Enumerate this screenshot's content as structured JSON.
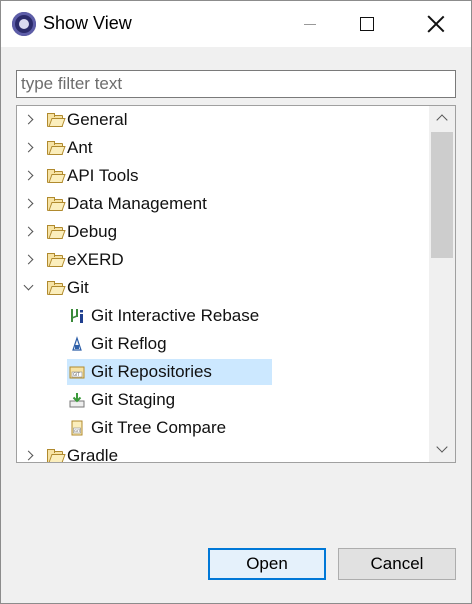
{
  "window": {
    "title": "Show View",
    "icon": "eclipse-app-icon"
  },
  "filter": {
    "value": "",
    "placeholder": "type filter text"
  },
  "tree": {
    "items": [
      {
        "label": "General",
        "expanded": false,
        "icon": "folder-icon"
      },
      {
        "label": "Ant",
        "expanded": false,
        "icon": "folder-icon"
      },
      {
        "label": "API Tools",
        "expanded": false,
        "icon": "folder-icon"
      },
      {
        "label": "Data Management",
        "expanded": false,
        "icon": "folder-icon"
      },
      {
        "label": "Debug",
        "expanded": false,
        "icon": "folder-icon"
      },
      {
        "label": "eXERD",
        "expanded": false,
        "icon": "folder-icon"
      },
      {
        "label": "Git",
        "expanded": true,
        "icon": "folder-icon",
        "children": [
          {
            "label": "Git Interactive Rebase",
            "icon": "git-rebase-icon"
          },
          {
            "label": "Git Reflog",
            "icon": "git-reflog-icon"
          },
          {
            "label": "Git Repositories",
            "icon": "git-repositories-icon",
            "selected": true
          },
          {
            "label": "Git Staging",
            "icon": "git-staging-icon"
          },
          {
            "label": "Git Tree Compare",
            "icon": "git-tree-compare-icon"
          }
        ]
      },
      {
        "label": "Gradle",
        "expanded": false,
        "icon": "folder-icon"
      }
    ]
  },
  "buttons": {
    "open": "Open",
    "cancel": "Cancel"
  },
  "colors": {
    "selection": "#cce8ff",
    "default_button_border": "#0078d7"
  }
}
